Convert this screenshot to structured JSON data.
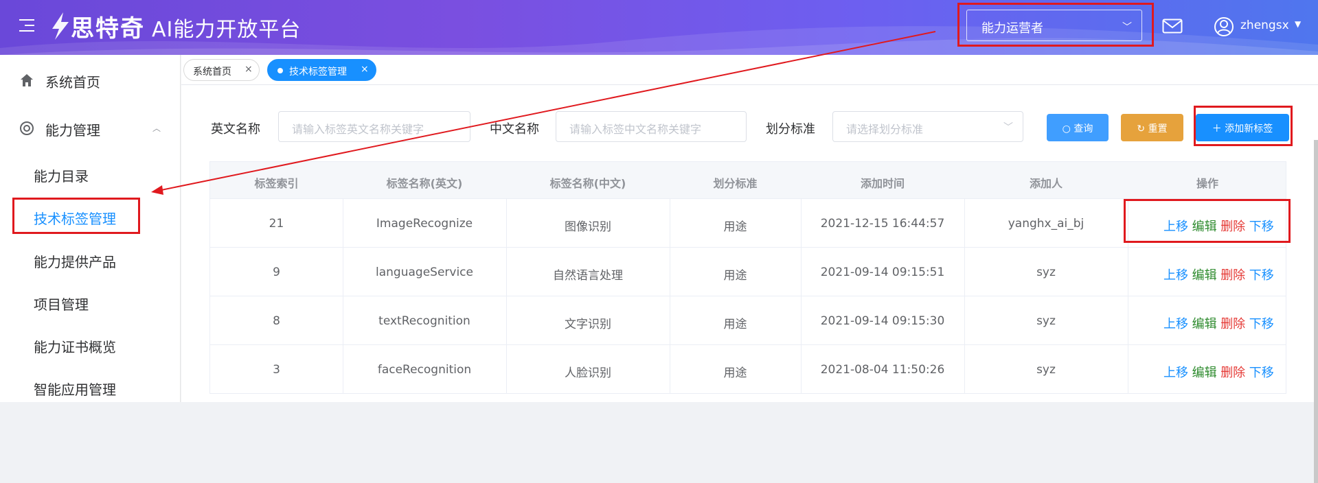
{
  "header": {
    "brand": "思特奇",
    "title": "AI能力开放平台",
    "role": "能力运营者",
    "username": "zhengsx"
  },
  "sidebar": {
    "items": [
      {
        "label": "系统首页",
        "icon": "home-icon"
      },
      {
        "label": "能力管理",
        "icon": "capability-icon"
      },
      {
        "label": "能力目录"
      },
      {
        "label": "技术标签管理"
      },
      {
        "label": "能力提供产品"
      },
      {
        "label": "项目管理"
      },
      {
        "label": "能力证书概览"
      },
      {
        "label": "智能应用管理"
      }
    ]
  },
  "tabs": [
    {
      "label": "系统首页",
      "close": "×"
    },
    {
      "label": "技术标签管理",
      "close": "×"
    }
  ],
  "filters": {
    "en_label": "英文名称",
    "en_placeholder": "请输入标签英文名称关键字",
    "cn_label": "中文名称",
    "cn_placeholder": "请输入标签中文名称关键字",
    "std_label": "划分标准",
    "std_placeholder": "请选择划分标准",
    "query_btn": "查询",
    "reset_btn": "重置",
    "add_btn": "添加新标签"
  },
  "table": {
    "headers": [
      "标签索引",
      "标签名称(英文)",
      "标签名称(中文)",
      "划分标准",
      "添加时间",
      "添加人",
      "操作"
    ],
    "rows": [
      [
        "21",
        "ImageRecognize",
        "图像识别",
        "用途",
        "2021-12-15 16:44:57",
        "yanghx_ai_bj"
      ],
      [
        "9",
        "languageService",
        "自然语言处理",
        "用途",
        "2021-09-14 09:15:51",
        "syz"
      ],
      [
        "8",
        "textRecognition",
        "文字识别",
        "用途",
        "2021-09-14 09:15:30",
        "syz"
      ],
      [
        "3",
        "faceRecognition",
        "人脸识别",
        "用途",
        "2021-08-04 11:50:26",
        "syz"
      ]
    ],
    "ops": {
      "up": "上移",
      "edit": "编辑",
      "del": "删除",
      "down": "下移"
    }
  },
  "colors": {
    "primary": "#1890ff",
    "query": "#409eff",
    "reset": "#e6a23c",
    "annotation": "#e0191e"
  }
}
